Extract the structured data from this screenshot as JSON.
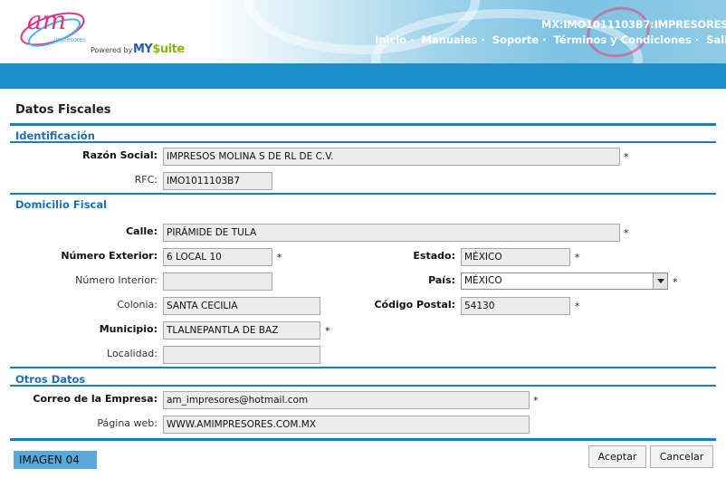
{
  "header": {
    "logo_text": "am",
    "logo_subtext": "impresores",
    "powered_by": "Powered by",
    "brand_my": "MY",
    "brand_suite": "$uite",
    "account": "MX:IMO1011103B7:IMPRESORES",
    "nav": [
      "Inicio",
      "Manuales",
      "Soporte",
      "Términos y Condiciones",
      "Salir"
    ]
  },
  "page": {
    "title": "Datos Fiscales"
  },
  "identificacion": {
    "title": "Identificación",
    "razon_social_label": "Razón Social:",
    "razon_social": "IMPRESOS MOLINA S DE RL DE C.V.",
    "rfc_label": "RFC:",
    "rfc": "IMO1011103B7"
  },
  "domicilio": {
    "title": "Domicilio Fiscal",
    "calle_label": "Calle:",
    "calle": "PIRÁMIDE DE TULA",
    "num_ext_label": "Número Exterior:",
    "num_ext": "6 LOCAL 10",
    "num_int_label": "Número Interior:",
    "num_int": "",
    "colonia_label": "Colonia:",
    "colonia": "SANTA CECILIA",
    "municipio_label": "Municipio:",
    "municipio": "TLALNEPANTLA DE BAZ",
    "localidad_label": "Localidad:",
    "localidad": "",
    "estado_label": "Estado:",
    "estado": "MÉXICO",
    "pais_label": "País:",
    "pais": "MÉXICO",
    "cp_label": "Código Postal:",
    "cp": "54130"
  },
  "otros": {
    "title": "Otros Datos",
    "correo_label": "Correo de la Empresa:",
    "correo": "am_impresores@hotmail.com",
    "web_label": "Página web:",
    "web": "WWW.AMIMPRESORES.COM.MX"
  },
  "required_mark": "*",
  "footer": {
    "badge": "IMAGEN 04",
    "accept": "Aceptar",
    "cancel": "Cancelar"
  },
  "colors": {
    "accent": "#1a7fc1",
    "bar": "#1d8fc8",
    "section_title": "#1a6fb5",
    "logo_pink": "#d9368b"
  }
}
